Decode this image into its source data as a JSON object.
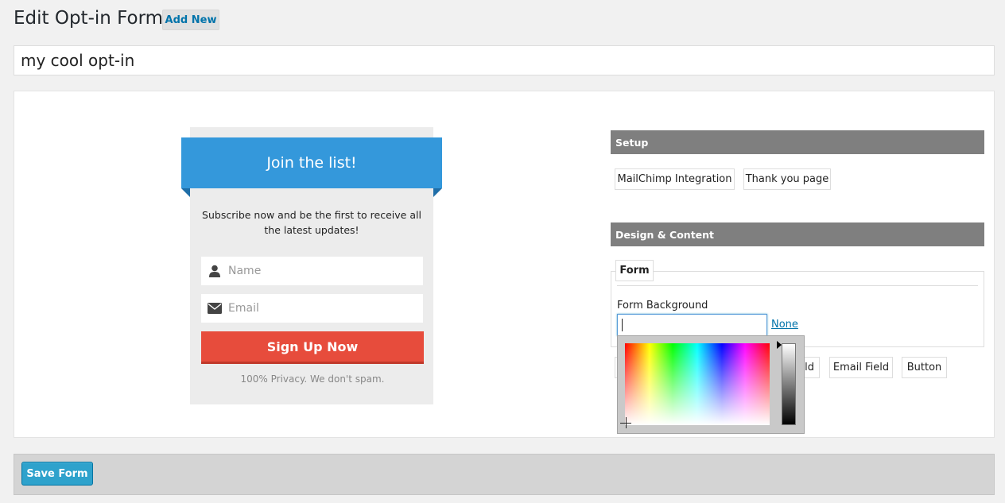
{
  "header": {
    "title": "Edit Opt-in Form",
    "add_new_label": "Add New"
  },
  "form_title": {
    "value": "my cool opt-in"
  },
  "preview": {
    "heading": "Join the list!",
    "description": "Subscribe now and be the first to receive all the latest updates!",
    "name_placeholder": "Name",
    "email_placeholder": "Email",
    "button_label": "Sign Up Now",
    "privacy_note": "100% Privacy. We don't spam.",
    "accent_color": "#3498db",
    "button_color": "#e74c3c",
    "user_icon": "user-icon",
    "envelope_icon": "envelope-icon"
  },
  "settings": {
    "setup_title": "Setup",
    "setup_tabs": [
      "MailChimp Integration",
      "Thank you page"
    ],
    "design_title": "Design & Content",
    "form_tab": "Form",
    "form_background_label": "Form Background",
    "form_background_value": "",
    "none_link": "None",
    "element_tabs": [
      "ld",
      "Email Field",
      "Button"
    ]
  },
  "footer": {
    "save_label": "Save Form"
  }
}
